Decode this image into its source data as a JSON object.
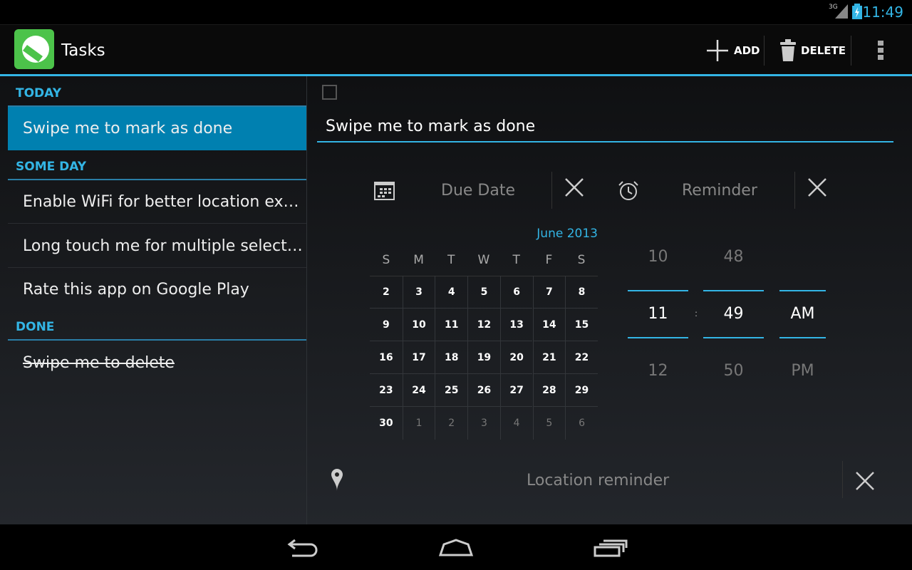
{
  "status_bar": {
    "network": "3G",
    "time": "11:49"
  },
  "action_bar": {
    "title": "Tasks",
    "add_label": "ADD",
    "delete_label": "DELETE"
  },
  "task_list": {
    "sections": [
      {
        "header": "TODAY",
        "items": [
          "Swipe me to mark as done"
        ]
      },
      {
        "header": "SOME DAY",
        "items": [
          "Enable WiFi for better location experience",
          "Long touch me for multiple selection",
          "Rate this app on Google Play"
        ]
      },
      {
        "header": "DONE",
        "items": [
          "Swipe me to delete"
        ]
      }
    ],
    "selected": "Swipe me to mark as done"
  },
  "detail": {
    "task_title": "Swipe me to mark as done",
    "due_date_label": "Due Date",
    "reminder_label": "Reminder",
    "location_label": "Location reminder",
    "calendar": {
      "month": "June 2013",
      "weekdays": [
        "S",
        "M",
        "T",
        "W",
        "T",
        "F",
        "S"
      ],
      "weeks": [
        [
          "2",
          "3",
          "4",
          "5",
          "6",
          "7",
          "8"
        ],
        [
          "9",
          "10",
          "11",
          "12",
          "13",
          "14",
          "15"
        ],
        [
          "16",
          "17",
          "18",
          "19",
          "20",
          "21",
          "22"
        ],
        [
          "23",
          "24",
          "25",
          "26",
          "27",
          "28",
          "29"
        ],
        [
          "30",
          "1",
          "2",
          "3",
          "4",
          "5",
          "6"
        ]
      ]
    },
    "time_picker": {
      "hour": {
        "prev": "10",
        "current": "11",
        "next": "12"
      },
      "separator": ":",
      "minute": {
        "prev": "48",
        "current": "49",
        "next": "50"
      },
      "ampm": {
        "current": "AM",
        "next": "PM"
      }
    }
  },
  "colors": {
    "accent": "#33b5e5",
    "selected_row": "#0080b0",
    "logo": "#4cc34a"
  }
}
